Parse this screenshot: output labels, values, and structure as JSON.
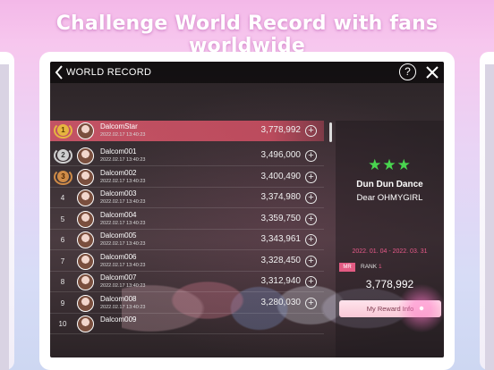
{
  "headline": "Challenge World Record with fans worldwide",
  "window": {
    "title": "WORLD RECORD",
    "help_label": "?"
  },
  "my_entry": {
    "rank": "1",
    "name": "DalcomStar",
    "date": "2022.02.17 13:40:23",
    "score": "3,778,992"
  },
  "leaderboard": [
    {
      "rank": "2",
      "name": "Dalcom001",
      "date": "2022.02.17 13:40:23",
      "score": "3,496,000",
      "medal": "silver"
    },
    {
      "rank": "3",
      "name": "Dalcom002",
      "date": "2022.02.17 13:40:23",
      "score": "3,400,490",
      "medal": "bronze"
    },
    {
      "rank": "4",
      "name": "Dalcom003",
      "date": "2022.02.17 13:40:23",
      "score": "3,374,980"
    },
    {
      "rank": "5",
      "name": "Dalcom004",
      "date": "2022.02.17 13:40:23",
      "score": "3,359,750"
    },
    {
      "rank": "6",
      "name": "Dalcom005",
      "date": "2022.02.17 13:40:23",
      "score": "3,343,961"
    },
    {
      "rank": "7",
      "name": "Dalcom006",
      "date": "2022.02.17 13:40:23",
      "score": "3,328,450"
    },
    {
      "rank": "8",
      "name": "Dalcom007",
      "date": "2022.02.17 13:40:23",
      "score": "3,312,940"
    },
    {
      "rank": "9",
      "name": "Dalcom008",
      "date": "2022.02.17 13:40:23",
      "score": "3,280,030"
    },
    {
      "rank": "10",
      "name": "Dalcom009",
      "date": "",
      "score": ""
    }
  ],
  "song": {
    "stars": "★★★",
    "title": "Dun Dun Dance",
    "artist": "Dear OHMYGIRL",
    "period": "2022. 01. 04 - 2022. 03. 31",
    "badge": "MR",
    "rank_label": "RANK",
    "rank_value": "1",
    "score": "3,778,992",
    "reward_button": "My Reward Info"
  },
  "colors": {
    "accent_pink": "#e35b83",
    "star_green": "#49d64f"
  },
  "icons": {
    "back": "chevron-left-icon",
    "help": "question-circle-icon",
    "close": "close-icon",
    "add": "plus-circle-icon"
  }
}
